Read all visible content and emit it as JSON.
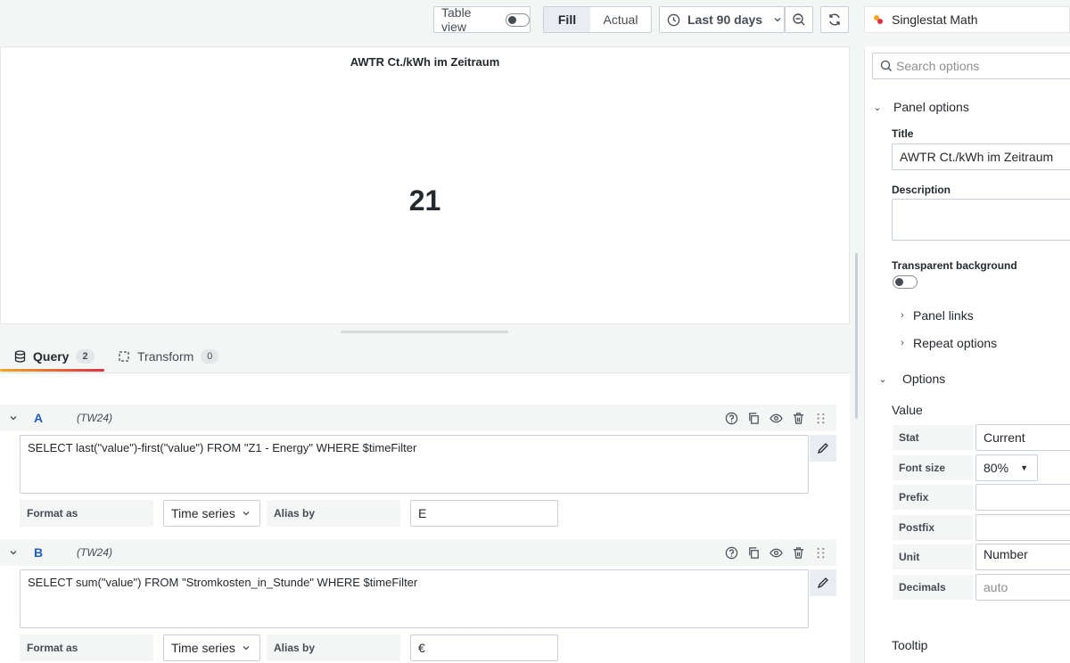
{
  "toolbar": {
    "table_view_label": "Table view",
    "fill_label": "Fill",
    "actual_label": "Actual",
    "time_range_label": "Last 90 days",
    "zoom_out_icon": "zoom-out-icon",
    "refresh_icon": "refresh-icon"
  },
  "panel": {
    "plugin_name": "Singlestat Math",
    "title": "AWTR Ct./kWh im Zeitraum",
    "value": "21"
  },
  "tabs": [
    {
      "label": "Query",
      "count": "2"
    },
    {
      "label": "Transform",
      "count": "0"
    }
  ],
  "queries": [
    {
      "ref_id": "A",
      "datasource": "(TW24)",
      "sql": "SELECT last(\"value\")-first(\"value\") FROM \"Z1 - Energy\" WHERE $timeFilter",
      "format_label": "Format as",
      "format_value": "Time series",
      "alias_label": "Alias by",
      "alias_value": "E"
    },
    {
      "ref_id": "B",
      "datasource": "(TW24)",
      "sql": "SELECT sum(\"value\") FROM \"Stromkosten_in_Stunde\" WHERE $timeFilter",
      "format_label": "Format as",
      "format_value": "Time series",
      "alias_label": "Alias by",
      "alias_value": "€"
    }
  ],
  "options": {
    "search_placeholder": "Search options",
    "panel_options_label": "Panel options",
    "title_label": "Title",
    "title_value": "AWTR Ct./kWh im Zeitraum",
    "description_label": "Description",
    "transparent_label": "Transparent background",
    "panel_links_label": "Panel links",
    "repeat_options_label": "Repeat options",
    "options_label": "Options",
    "value_label": "Value",
    "stat_label": "Stat",
    "stat_value": "Current",
    "font_size_label": "Font size",
    "font_size_value": "80%",
    "prefix_label": "Prefix",
    "postfix_label": "Postfix",
    "unit_label": "Unit",
    "unit_value": "Number",
    "decimals_label": "Decimals",
    "decimals_placeholder": "auto",
    "tooltip_label": "Tooltip"
  },
  "colors": {
    "accent_blue": "#1f60c4",
    "tab_gradient_start": "#f5a623",
    "tab_gradient_end": "#e02f44"
  }
}
